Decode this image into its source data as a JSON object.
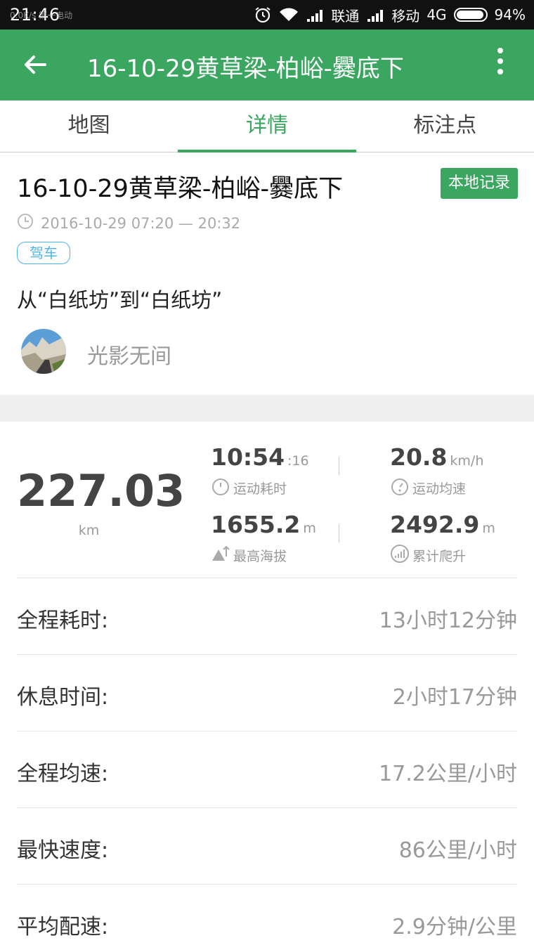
{
  "status_bar": {
    "time": "21:46",
    "ghost_text": "0.0K/s 第一电动",
    "carrier1": "联通",
    "carrier2": "移动",
    "network": "4G",
    "battery": "94%"
  },
  "app_bar": {
    "title": "16-10-29黄草梁-柏峪-爨底下",
    "icons": [
      "arrow-left-icon",
      "more-vertical-icon"
    ]
  },
  "tabs": [
    {
      "label": "地图",
      "active": false
    },
    {
      "label": "详情",
      "active": true
    },
    {
      "label": "标注点",
      "active": false
    }
  ],
  "header": {
    "title": "16-10-29黄草梁-柏峪-爨底下",
    "local_badge": "本地记录",
    "time_range": "2016-10-29 07:20 — 20:32",
    "mode_badge": "驾车",
    "route": "从“白纸坊”到“白纸坊”",
    "username": "光影无间"
  },
  "summary": {
    "distance": "227.03",
    "distance_unit": "km",
    "moving_time": "10:54",
    "moving_time_sec": ":16",
    "moving_time_label": "运动耗时",
    "avg_speed": "20.8",
    "avg_speed_unit": "km/h",
    "avg_speed_label": "运动均速",
    "max_altitude": "1655.2",
    "max_altitude_unit": "m",
    "max_altitude_label": "最高海拔",
    "total_climb": "2492.9",
    "total_climb_unit": "m",
    "total_climb_label": "累计爬升"
  },
  "details": [
    {
      "label": "全程耗时:",
      "value": "13小时12分钟"
    },
    {
      "label": "休息时间:",
      "value": "2小时17分钟"
    },
    {
      "label": "全程均速:",
      "value": "17.2公里/小时"
    },
    {
      "label": "最快速度:",
      "value": "86公里/小时"
    },
    {
      "label": "平均配速:",
      "value": "2.9分钟/公里"
    }
  ],
  "colors": {
    "brand_green": "#3aa660",
    "mode_blue": "#4fb3e8"
  }
}
